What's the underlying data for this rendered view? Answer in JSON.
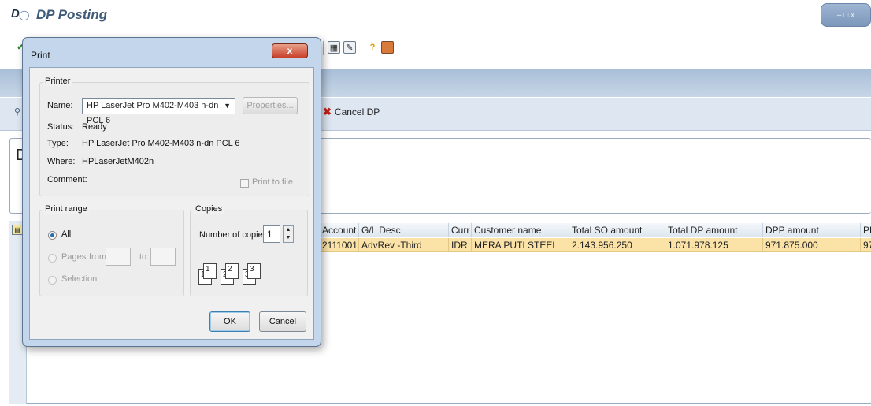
{
  "window": {
    "title": "DP Posting",
    "controls": "– □ x"
  },
  "page_header": {
    "title": "D"
  },
  "app_toolbar": {
    "cancel_dp_label": "Cancel DP"
  },
  "group": {
    "letter": "D"
  },
  "grid": {
    "columns": [
      "Account",
      "G/L Desc",
      "Curr",
      "Customer name",
      "Total SO amount",
      "Total DP amount",
      "DPP amount",
      "PF"
    ],
    "rows": [
      [
        "2111001",
        "AdvRev -Third",
        "IDR",
        "MERA PUTI STEEL",
        "2.143.956.250",
        "1.071.978.125",
        "971.875.000",
        "97"
      ]
    ]
  },
  "print_dialog": {
    "title": "Print",
    "close_label": "x",
    "printer_group": "Printer",
    "name_label": "Name:",
    "printer_name": "HP LaserJet Pro M402-M403 n-dn PCL 6",
    "properties_label": "Properties...",
    "status_label": "Status:",
    "status_value": "Ready",
    "type_label": "Type:",
    "type_value": "HP LaserJet Pro M402-M403 n-dn PCL 6",
    "where_label": "Where:",
    "where_value": "HPLaserJetM402n",
    "comment_label": "Comment:",
    "print_to_file_label": "Print to file",
    "print_range_group": "Print range",
    "all_label": "All",
    "pages_label": "Pages",
    "from_label": "from:",
    "to_label": "to:",
    "selection_label": "Selection",
    "copies_group": "Copies",
    "number_of_copies_label": "Number of copies:",
    "number_of_copies_value": "1",
    "collate_pages": [
      "1",
      "1",
      "2",
      "2",
      "3",
      "3"
    ],
    "ok_label": "OK",
    "cancel_label": "Cancel"
  }
}
